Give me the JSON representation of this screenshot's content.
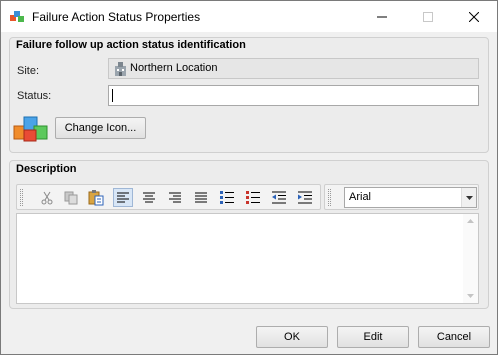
{
  "window": {
    "title": "Failure Action Status Properties"
  },
  "identification": {
    "group_title": "Failure follow up action status identification",
    "site_label": "Site:",
    "site_value": "Northern Location",
    "status_label": "Status:",
    "status_value": "",
    "change_icon_label": "Change Icon..."
  },
  "description": {
    "group_title": "Description",
    "toolbar_icons": [
      "cut-icon",
      "copy-icon",
      "paste-icon",
      "align-left-icon",
      "align-center-icon",
      "align-right-icon",
      "justify-icon",
      "bullet-list-icon",
      "numbered-list-icon",
      "outdent-icon",
      "indent-icon"
    ],
    "font_value": "Arial"
  },
  "buttons": {
    "ok_label": "OK",
    "edit_label": "Edit",
    "cancel_label": "Cancel"
  }
}
